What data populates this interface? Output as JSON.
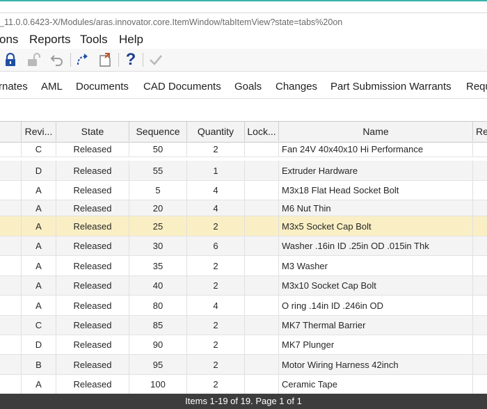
{
  "url": "_11.0.0.6423-X/Modules/aras.innovator.core.ItemWindow/tabItemView?state=tabs%20on",
  "menu": [
    "ons",
    "Reports",
    "Tools",
    "Help"
  ],
  "toolbar": {
    "icons": [
      "lock-icon",
      "unlock-icon",
      "undo-icon",
      "version-icon",
      "promote-icon",
      "help-icon",
      "done-icon"
    ],
    "colors": {
      "lock": "#1f4fa3",
      "disabled": "#b9b9b9",
      "help": "#1b3f8f",
      "promote": "#c0552b"
    }
  },
  "tabs": [
    "rnates",
    "AML",
    "Documents",
    "CAD Documents",
    "Goals",
    "Changes",
    "Part Submission Warrants",
    "Requ"
  ],
  "grid": {
    "columns": [
      "Revi...",
      "State",
      "Sequence",
      "Quantity",
      "Lock...",
      "Name",
      "Re"
    ],
    "rows": [
      {
        "rev": "C",
        "state": "Released",
        "seq": "50",
        "qty": "2",
        "lock": "",
        "name": "Fan 24V 40x40x10 Hi Performance"
      },
      {
        "rev": "D",
        "state": "Released",
        "seq": "55",
        "qty": "1",
        "lock": "",
        "name": "Extruder Hardware"
      },
      {
        "rev": "A",
        "state": "Released",
        "seq": "5",
        "qty": "4",
        "lock": "",
        "name": "M3x18 Flat Head Socket Bolt"
      },
      {
        "rev": "A",
        "state": "Released",
        "seq": "20",
        "qty": "4",
        "lock": "",
        "name": "M6 Nut Thin"
      },
      {
        "rev": "A",
        "state": "Released",
        "seq": "25",
        "qty": "2",
        "lock": "",
        "name": "M3x5 Socket Cap Bolt",
        "selected": true
      },
      {
        "rev": "A",
        "state": "Released",
        "seq": "30",
        "qty": "6",
        "lock": "",
        "name": "Washer .16in ID .25in OD .015in Thk"
      },
      {
        "rev": "A",
        "state": "Released",
        "seq": "35",
        "qty": "2",
        "lock": "",
        "name": "M3 Washer"
      },
      {
        "rev": "A",
        "state": "Released",
        "seq": "40",
        "qty": "2",
        "lock": "",
        "name": "M3x10 Socket Cap Bolt"
      },
      {
        "rev": "A",
        "state": "Released",
        "seq": "80",
        "qty": "4",
        "lock": "",
        "name": "O ring .14in ID .246in OD"
      },
      {
        "rev": "C",
        "state": "Released",
        "seq": "85",
        "qty": "2",
        "lock": "",
        "name": "MK7 Thermal Barrier"
      },
      {
        "rev": "D",
        "state": "Released",
        "seq": "90",
        "qty": "2",
        "lock": "",
        "name": "MK7 Plunger"
      },
      {
        "rev": "B",
        "state": "Released",
        "seq": "95",
        "qty": "2",
        "lock": "",
        "name": "Motor Wiring Harness 42inch"
      },
      {
        "rev": "A",
        "state": "Released",
        "seq": "100",
        "qty": "2",
        "lock": "",
        "name": "Ceramic Tape"
      }
    ]
  },
  "status": "Items 1-19 of 19. Page 1 of 1",
  "colors": {
    "accent": "#39b3aa",
    "selected_row": "#faefc4",
    "statusbar": "#3d3d3d"
  }
}
